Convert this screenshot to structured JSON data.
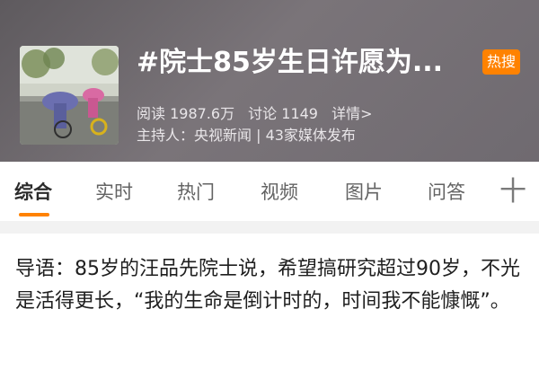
{
  "header": {
    "title": "#院士85岁生日许愿为...",
    "badge": "热搜",
    "stats": {
      "reads": "阅读 1987.6万",
      "discussions": "讨论 1149",
      "detail_link": "详情>"
    },
    "host": "主持人：央视新闻 | 43家媒体发布",
    "thumbnail_icon": "topic-cover-image"
  },
  "tabs": [
    {
      "label": "综合",
      "active": true
    },
    {
      "label": "实时",
      "active": false
    },
    {
      "label": "热门",
      "active": false
    },
    {
      "label": "视频",
      "active": false
    },
    {
      "label": "图片",
      "active": false
    },
    {
      "label": "问答",
      "active": false
    }
  ],
  "tab_more_symbol": "十",
  "guide": {
    "text": "导语：85岁的汪品先院士说，希望搞研究超过90岁，不光是活得更长，“我的生命是倒计时的，时间我不能慷慨”。"
  },
  "colors": {
    "accent": "#ff8200",
    "header_bg": "#6f6a70"
  }
}
